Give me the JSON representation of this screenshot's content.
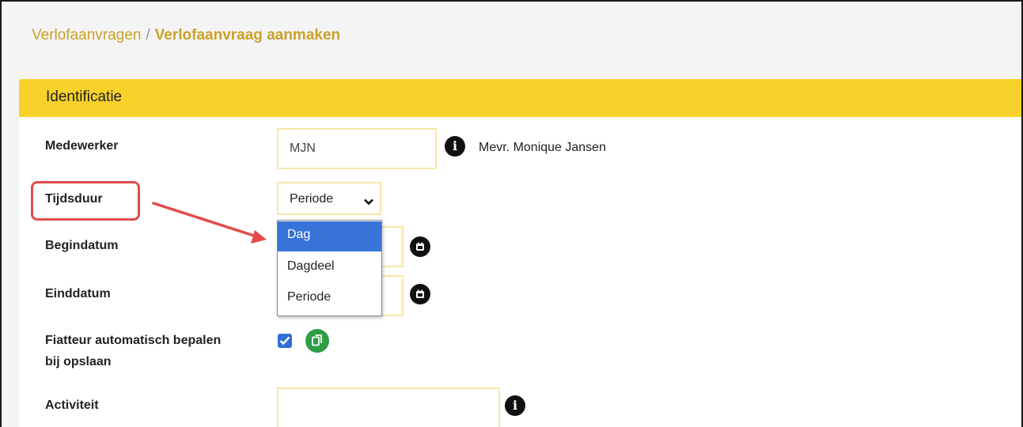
{
  "breadcrumb": {
    "parent": "Verlofaanvragen",
    "separator": "/",
    "current": "Verlofaanvraag aanmaken"
  },
  "section": {
    "title": "Identificatie"
  },
  "form": {
    "medewerker": {
      "label": "Medewerker",
      "value": "MJN",
      "resolved_name": "Mevr. Monique Jansen"
    },
    "tijdsduur": {
      "label": "Tijdsduur",
      "selected": "Periode",
      "options": [
        "Dag",
        "Dagdeel",
        "Periode"
      ],
      "highlighted_option": "Dag"
    },
    "begindatum": {
      "label": "Begindatum",
      "value": ""
    },
    "einddatum": {
      "label": "Einddatum",
      "value": ""
    },
    "fiatteur": {
      "label_line1": "Fiatteur automatisch bepalen",
      "label_line2": "bij opslaan",
      "checked": true
    },
    "activiteit": {
      "label": "Activiteit",
      "value": ""
    }
  },
  "icons": {
    "info": "info-icon",
    "calendar": "calendar-icon",
    "copy": "copy-icon",
    "chevron": "chevron-down-icon"
  },
  "colors": {
    "header_bg": "#f8d12b",
    "breadcrumb": "#c9a227",
    "field_border": "#f8e6a8",
    "dropdown_selected": "#3874d8",
    "annotation_red": "#e34b4b",
    "checkbox": "#2f6fd6",
    "copy_button": "#2f9e44"
  }
}
